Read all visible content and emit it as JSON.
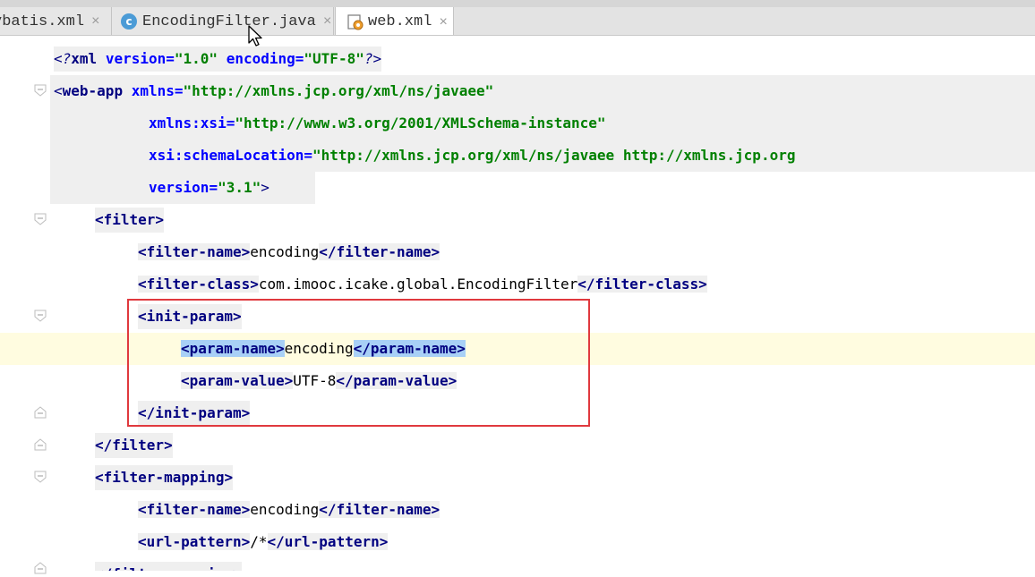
{
  "tabs": [
    {
      "label": "ybatis.xml",
      "icon": "xml-file-icon"
    },
    {
      "label": "EncodingFilter.java",
      "icon": "java-class-icon"
    },
    {
      "label": "web.xml",
      "icon": "xml-file-icon",
      "active": true
    }
  ],
  "close_glyph": "×",
  "class_icon_letter": "c",
  "colors": {
    "tag": "#000080",
    "attribute": "#0000ff",
    "string": "#008000",
    "highlight": "#a8d0f6",
    "current_line": "#fffce0",
    "annotation_box": "#e0393e"
  },
  "code": {
    "l1": {
      "open": "<?",
      "name": "xml",
      "attr1": "version",
      "eq1": "=",
      "val1": "\"1.0\"",
      "attr2": "encoding",
      "eq2": "=",
      "val2": "\"UTF-8\"",
      "close": "?>"
    },
    "l2": {
      "open": "<",
      "tag": "web-app",
      "attr": "xmlns",
      "eq": "=",
      "val": "\"http://xmlns.jcp.org/xml/ns/javaee\""
    },
    "l3": {
      "attr": "xmlns:xsi",
      "eq": "=",
      "val": "\"http://www.w3.org/2001/XMLSchema-instance\""
    },
    "l4": {
      "attr": "xsi:schemaLocation",
      "eq": "=",
      "val": "\"http://xmlns.jcp.org/xml/ns/javaee http://xmlns.jcp.org"
    },
    "l5": {
      "attr": "version",
      "eq": "=",
      "val": "\"3.1\"",
      "close": ">"
    },
    "l6": {
      "text": "<filter>"
    },
    "l7": {
      "open": "<filter-name>",
      "value": "encoding",
      "close": "</filter-name>"
    },
    "l8": {
      "open": "<filter-class>",
      "value": "com.imooc.icake.global.EncodingFilter",
      "close": "</filter-class>"
    },
    "l9": {
      "text": "<init-param>"
    },
    "l10": {
      "open": "<param-name>",
      "value": "encoding",
      "close": "</param-name>"
    },
    "l11": {
      "open": "<param-value>",
      "value": "UTF-8",
      "close": "</param-value>"
    },
    "l12": {
      "text": "</init-param>"
    },
    "l13": {
      "text": "</filter>"
    },
    "l14": {
      "text": "<filter-mapping>"
    },
    "l15": {
      "open": "<filter-name>",
      "value": "encoding",
      "close": "</filter-name>"
    },
    "l16": {
      "open": "<url-pattern>",
      "value": "/*",
      "close": "</url-pattern>"
    },
    "l17": {
      "text": "</filter-mapping>"
    }
  }
}
